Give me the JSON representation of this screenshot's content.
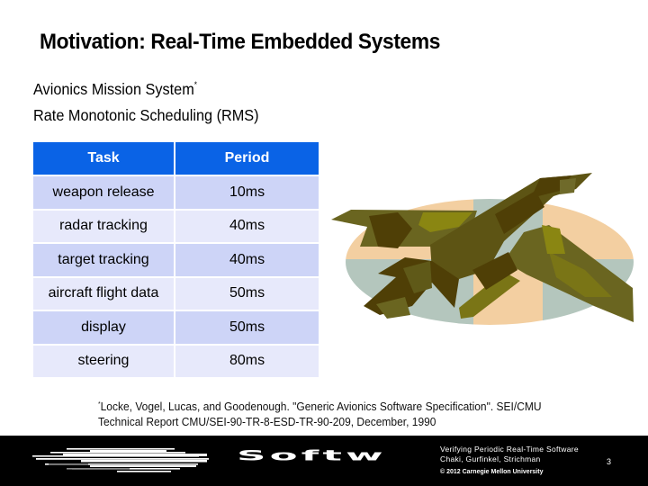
{
  "slide": {
    "title": "Motivation: Real-Time Embedded Systems",
    "subtitle_lines": [
      {
        "text": "Avionics Mission System",
        "marker": "*"
      },
      {
        "text": "Rate Monotonic Scheduling (RMS)",
        "marker": ""
      }
    ]
  },
  "task_table": {
    "headers": [
      "Task",
      "Period"
    ],
    "rows": [
      {
        "task": "weapon release",
        "period": "10ms"
      },
      {
        "task": "radar tracking",
        "period": "40ms"
      },
      {
        "task": "target tracking",
        "period": "40ms"
      },
      {
        "task": "aircraft flight data",
        "period": "50ms"
      },
      {
        "task": "display",
        "period": "50ms"
      },
      {
        "task": "steering",
        "period": "80ms"
      }
    ],
    "colors": {
      "header": "#0a63e6",
      "row_odd": "#cdd4f7",
      "row_even": "#e7e9fb"
    }
  },
  "footnote": {
    "marker": "*",
    "line1": "Locke, Vogel, Lucas, and Goodenough. \"Generic Avionics Software Specification\". SEI/CMU",
    "line2": "Technical Report CMU/SEI-90-TR-8-ESD-TR-90-209, December, 1990"
  },
  "illustration": {
    "icon": "fighter-jet-camouflage-icon",
    "colors": {
      "peach": "#f3cfa1",
      "gray": "#b4c6bd",
      "olive_dark": "#4f3f06",
      "olive": "#6a6520",
      "olive_light": "#8a8612"
    }
  },
  "footer": {
    "wordmark": "Softw",
    "logo_icon": "sei-striped-logo-icon",
    "talk_title": "Verifying Periodic Real-Time Software",
    "authors": "Chaki, Gurfinkel, Strichman",
    "copyright": "© 2012 Carnegie Mellon University",
    "page_number": "3"
  }
}
